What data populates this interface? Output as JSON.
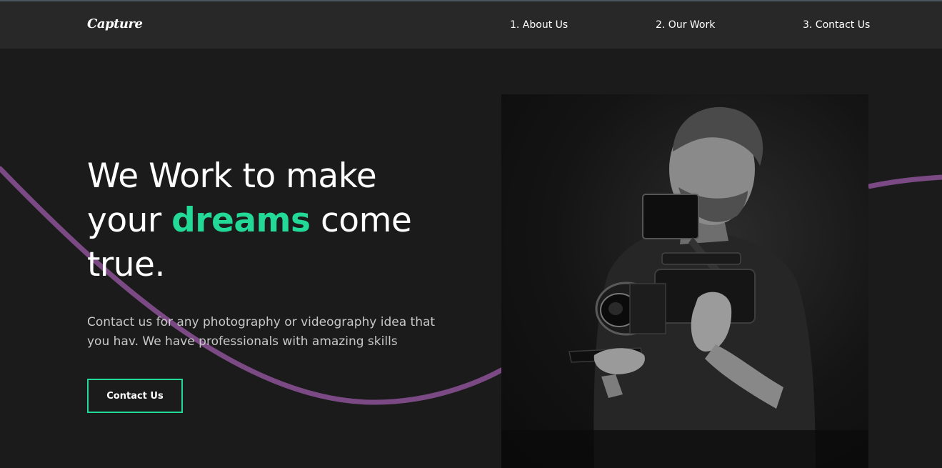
{
  "nav": {
    "logo": "Capture",
    "links": [
      {
        "label": "1. About Us"
      },
      {
        "label": "2. Our Work"
      },
      {
        "label": "3. Contact Us"
      }
    ]
  },
  "hero": {
    "headline_line1": "We Work to make",
    "headline_your": "your",
    "headline_accent": "dreams",
    "headline_come": "come",
    "headline_line3": "true.",
    "description": "Contact us for any photography or videography idea that you hav. We have professionals with amazing skills",
    "cta_label": "Contact Us"
  },
  "colors": {
    "accent": "#23d997",
    "wave": "#7b4a85",
    "background": "#1b1b1b",
    "navbar": "#282828"
  },
  "image": {
    "icon": "photographer-with-camera-image"
  }
}
